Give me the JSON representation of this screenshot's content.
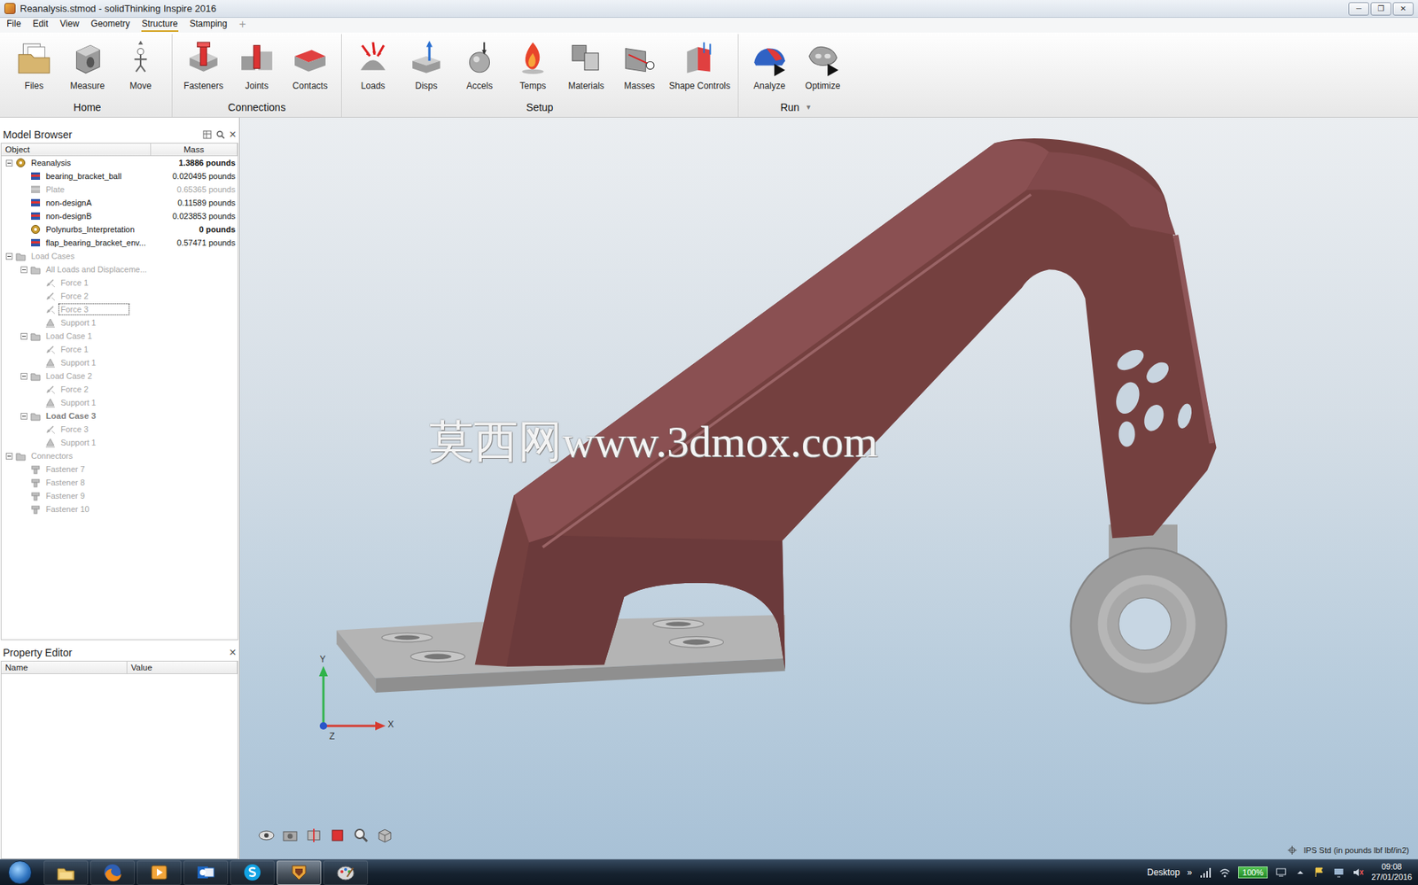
{
  "window": {
    "title": "Reanalysis.stmod - solidThinking Inspire 2016",
    "controls": [
      "─",
      "❐",
      "✕"
    ]
  },
  "menu": [
    {
      "label": "File",
      "selected": false,
      "kind": "tab"
    },
    {
      "label": "Edit",
      "selected": false,
      "kind": "tab"
    },
    {
      "label": "View",
      "selected": false,
      "kind": "tab"
    },
    {
      "label": "Geometry",
      "selected": false,
      "kind": "tab"
    },
    {
      "label": "Structure",
      "selected": true,
      "kind": "tab"
    },
    {
      "label": "Stamping",
      "selected": false,
      "kind": "tab"
    },
    {
      "label": "+",
      "selected": false,
      "kind": "add"
    }
  ],
  "ribbon": {
    "groups": [
      {
        "label": "Home",
        "tools": [
          "Files",
          "Measure",
          "Move"
        ]
      },
      {
        "label": "Connections",
        "tools": [
          "Fasteners",
          "Joints",
          "Contacts"
        ]
      },
      {
        "label": "Setup",
        "tools": [
          "Loads",
          "Disps",
          "Accels",
          "Temps",
          "Materials",
          "Masses",
          "Shape Controls"
        ]
      },
      {
        "label": "Run",
        "arrow": "▼",
        "tools": [
          "Analyze",
          "Optimize"
        ]
      }
    ]
  },
  "model_browser": {
    "title": "Model Browser",
    "close": "×",
    "columns": [
      "Object",
      "Mass"
    ],
    "rows": [
      {
        "label": "Reanalysis",
        "mass": "1.3886 pounds",
        "depth": 0,
        "kind": "assembly",
        "expandable": true,
        "expanded": true,
        "disabled": false,
        "label_bold": false,
        "mass_bold": true,
        "selected": false
      },
      {
        "label": "bearing_bracket_ball",
        "mass": "0.020495 pounds",
        "depth": 1,
        "kind": "part",
        "expandable": false,
        "expanded": false,
        "disabled": false,
        "label_bold": false,
        "mass_bold": false,
        "selected": false
      },
      {
        "label": "Plate",
        "mass": "0.65365 pounds",
        "depth": 1,
        "kind": "part",
        "expandable": false,
        "expanded": false,
        "disabled": true,
        "label_bold": false,
        "mass_bold": false,
        "selected": false
      },
      {
        "label": "non-designA",
        "mass": "0.11589 pounds",
        "depth": 1,
        "kind": "part",
        "expandable": false,
        "expanded": false,
        "disabled": false,
        "label_bold": false,
        "mass_bold": false,
        "selected": false
      },
      {
        "label": "non-designB",
        "mass": "0.023853 pounds",
        "depth": 1,
        "kind": "part",
        "expandable": false,
        "expanded": false,
        "disabled": false,
        "label_bold": false,
        "mass_bold": false,
        "selected": false
      },
      {
        "label": "Polynurbs_Interpretation",
        "mass": "0 pounds",
        "depth": 1,
        "kind": "assembly",
        "expandable": false,
        "expanded": false,
        "disabled": false,
        "label_bold": false,
        "mass_bold": true,
        "selected": false
      },
      {
        "label": "flap_bearing_bracket_env...",
        "mass": "0.57471 pounds",
        "depth": 1,
        "kind": "part",
        "expandable": false,
        "expanded": false,
        "disabled": false,
        "label_bold": false,
        "mass_bold": false,
        "selected": false
      },
      {
        "label": "Load Cases",
        "depth": 0,
        "kind": "folder",
        "expandable": true,
        "expanded": true,
        "disabled": true,
        "label_bold": false,
        "mass_bold": false,
        "selected": false
      },
      {
        "label": "All Loads and Displaceme...",
        "depth": 1,
        "kind": "folder",
        "expandable": true,
        "expanded": true,
        "disabled": true,
        "label_bold": false,
        "mass_bold": false,
        "selected": false
      },
      {
        "label": "Force 1",
        "depth": 2,
        "kind": "force",
        "expandable": false,
        "expanded": false,
        "disabled": true,
        "label_bold": false,
        "mass_bold": false,
        "selected": false
      },
      {
        "label": "Force 2",
        "depth": 2,
        "kind": "force",
        "expandable": false,
        "expanded": false,
        "disabled": true,
        "label_bold": false,
        "mass_bold": false,
        "selected": false
      },
      {
        "label": "Force 3",
        "depth": 2,
        "kind": "force",
        "expandable": false,
        "expanded": false,
        "disabled": true,
        "label_bold": false,
        "mass_bold": false,
        "selected": true
      },
      {
        "label": "Support 1",
        "depth": 2,
        "kind": "support",
        "expandable": false,
        "expanded": false,
        "disabled": true,
        "label_bold": false,
        "mass_bold": false,
        "selected": false
      },
      {
        "label": "Load Case 1",
        "depth": 1,
        "kind": "folder",
        "expandable": true,
        "expanded": true,
        "disabled": true,
        "label_bold": false,
        "mass_bold": false,
        "selected": false
      },
      {
        "label": "Force 1",
        "depth": 2,
        "kind": "force",
        "expandable": false,
        "expanded": false,
        "disabled": true,
        "label_bold": false,
        "mass_bold": false,
        "selected": false
      },
      {
        "label": "Support 1",
        "depth": 2,
        "kind": "support",
        "expandable": false,
        "expanded": false,
        "disabled": true,
        "label_bold": false,
        "mass_bold": false,
        "selected": false
      },
      {
        "label": "Load Case 2",
        "depth": 1,
        "kind": "folder",
        "expandable": true,
        "expanded": true,
        "disabled": true,
        "label_bold": false,
        "mass_bold": false,
        "selected": false
      },
      {
        "label": "Force 2",
        "depth": 2,
        "kind": "force",
        "expandable": false,
        "expanded": false,
        "disabled": true,
        "label_bold": false,
        "mass_bold": false,
        "selected": false
      },
      {
        "label": "Support 1",
        "depth": 2,
        "kind": "support",
        "expandable": false,
        "expanded": false,
        "disabled": true,
        "label_bold": false,
        "mass_bold": false,
        "selected": false
      },
      {
        "label": "Load Case 3",
        "depth": 1,
        "kind": "folder",
        "expandable": true,
        "expanded": true,
        "disabled": true,
        "label_bold": true,
        "mass_bold": false,
        "selected": false
      },
      {
        "label": "Force 3",
        "depth": 2,
        "kind": "force",
        "expandable": false,
        "expanded": false,
        "disabled": true,
        "label_bold": false,
        "mass_bold": false,
        "selected": false
      },
      {
        "label": "Support 1",
        "depth": 2,
        "kind": "support",
        "expandable": false,
        "expanded": false,
        "disabled": true,
        "label_bold": false,
        "mass_bold": false,
        "selected": false
      },
      {
        "label": "Connectors",
        "depth": 0,
        "kind": "folder",
        "expandable": true,
        "expanded": true,
        "disabled": true,
        "label_bold": false,
        "mass_bold": false,
        "selected": false
      },
      {
        "label": "Fastener 7",
        "depth": 1,
        "kind": "fastener",
        "expandable": false,
        "expanded": false,
        "disabled": true,
        "label_bold": false,
        "mass_bold": false,
        "selected": false
      },
      {
        "label": "Fastener 8",
        "depth": 1,
        "kind": "fastener",
        "expandable": false,
        "expanded": false,
        "disabled": true,
        "label_bold": false,
        "mass_bold": false,
        "selected": false
      },
      {
        "label": "Fastener 9",
        "depth": 1,
        "kind": "fastener",
        "expandable": false,
        "expanded": false,
        "disabled": true,
        "label_bold": false,
        "mass_bold": false,
        "selected": false
      },
      {
        "label": "Fastener 10",
        "depth": 1,
        "kind": "fastener",
        "expandable": false,
        "expanded": false,
        "disabled": true,
        "label_bold": false,
        "mass_bold": false,
        "selected": false
      }
    ]
  },
  "property_editor": {
    "title": "Property Editor",
    "close": "×",
    "columns": [
      "Name",
      "Value"
    ]
  },
  "viewport": {
    "watermark": "莫西网www.3dmox.com",
    "axes": {
      "y": "Y",
      "x": "X",
      "z": "Z"
    },
    "units": "IPS Std (in pounds lbf lbf/in2)"
  },
  "taskbar": {
    "apps": [
      {
        "selected": false
      },
      {
        "selected": false
      },
      {
        "selected": false
      },
      {
        "selected": false
      },
      {
        "selected": false
      },
      {
        "selected": true
      },
      {
        "selected": false
      }
    ],
    "desktop": "Desktop",
    "chevron": "»",
    "battery": "100%",
    "time": "09:08",
    "date": "27/01/2016"
  }
}
